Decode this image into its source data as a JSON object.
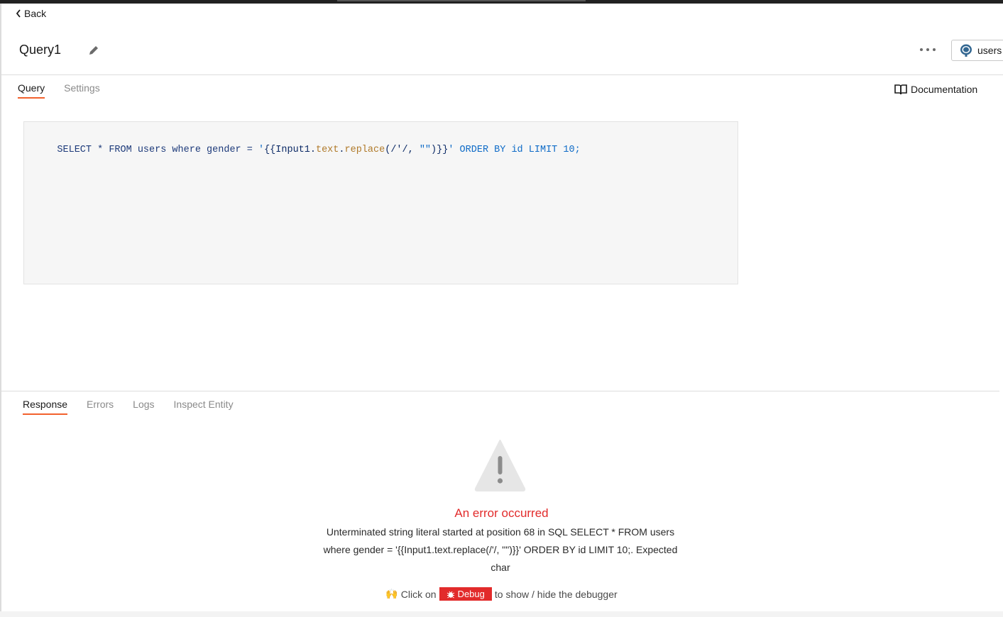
{
  "nav": {
    "back_label": "Back"
  },
  "header": {
    "title": "Query1",
    "datasource_label": "users"
  },
  "tabs": [
    "Query",
    "Settings"
  ],
  "documentation_label": "Documentation",
  "editor": {
    "tokens": [
      {
        "t": "SELECT * FROM users where gender = ",
        "c": "kw"
      },
      {
        "t": "'",
        "c": "tok-blue"
      },
      {
        "t": "{{",
        "c": "tok-dark"
      },
      {
        "t": "Input1.",
        "c": "tok-dark"
      },
      {
        "t": "text",
        "c": "tok-brown"
      },
      {
        "t": ".",
        "c": "tok-dark"
      },
      {
        "t": "replace",
        "c": "tok-brown"
      },
      {
        "t": "(/'/, ",
        "c": "tok-dark"
      },
      {
        "t": "\"\"",
        "c": "tok-blue"
      },
      {
        "t": ")}}",
        "c": "tok-dark"
      },
      {
        "t": "' ORDER BY id LIMIT 10;",
        "c": "tok-blue"
      }
    ]
  },
  "response_tabs": [
    "Response",
    "Errors",
    "Logs",
    "Inspect Entity"
  ],
  "error": {
    "title": "An error occurred",
    "message": "Unterminated string literal started at position 68 in SQL SELECT * FROM users where gender = '{{Input1.text.replace(/'/, \"\")}}' ORDER BY id LIMIT 10;. Expected char"
  },
  "hint": {
    "emoji": "🙌",
    "prefix": "Click on",
    "debug_label": "Debug",
    "suffix": "to show / hide the debugger"
  },
  "colors": {
    "accent": "#f2612d",
    "error": "#e22b2b"
  }
}
